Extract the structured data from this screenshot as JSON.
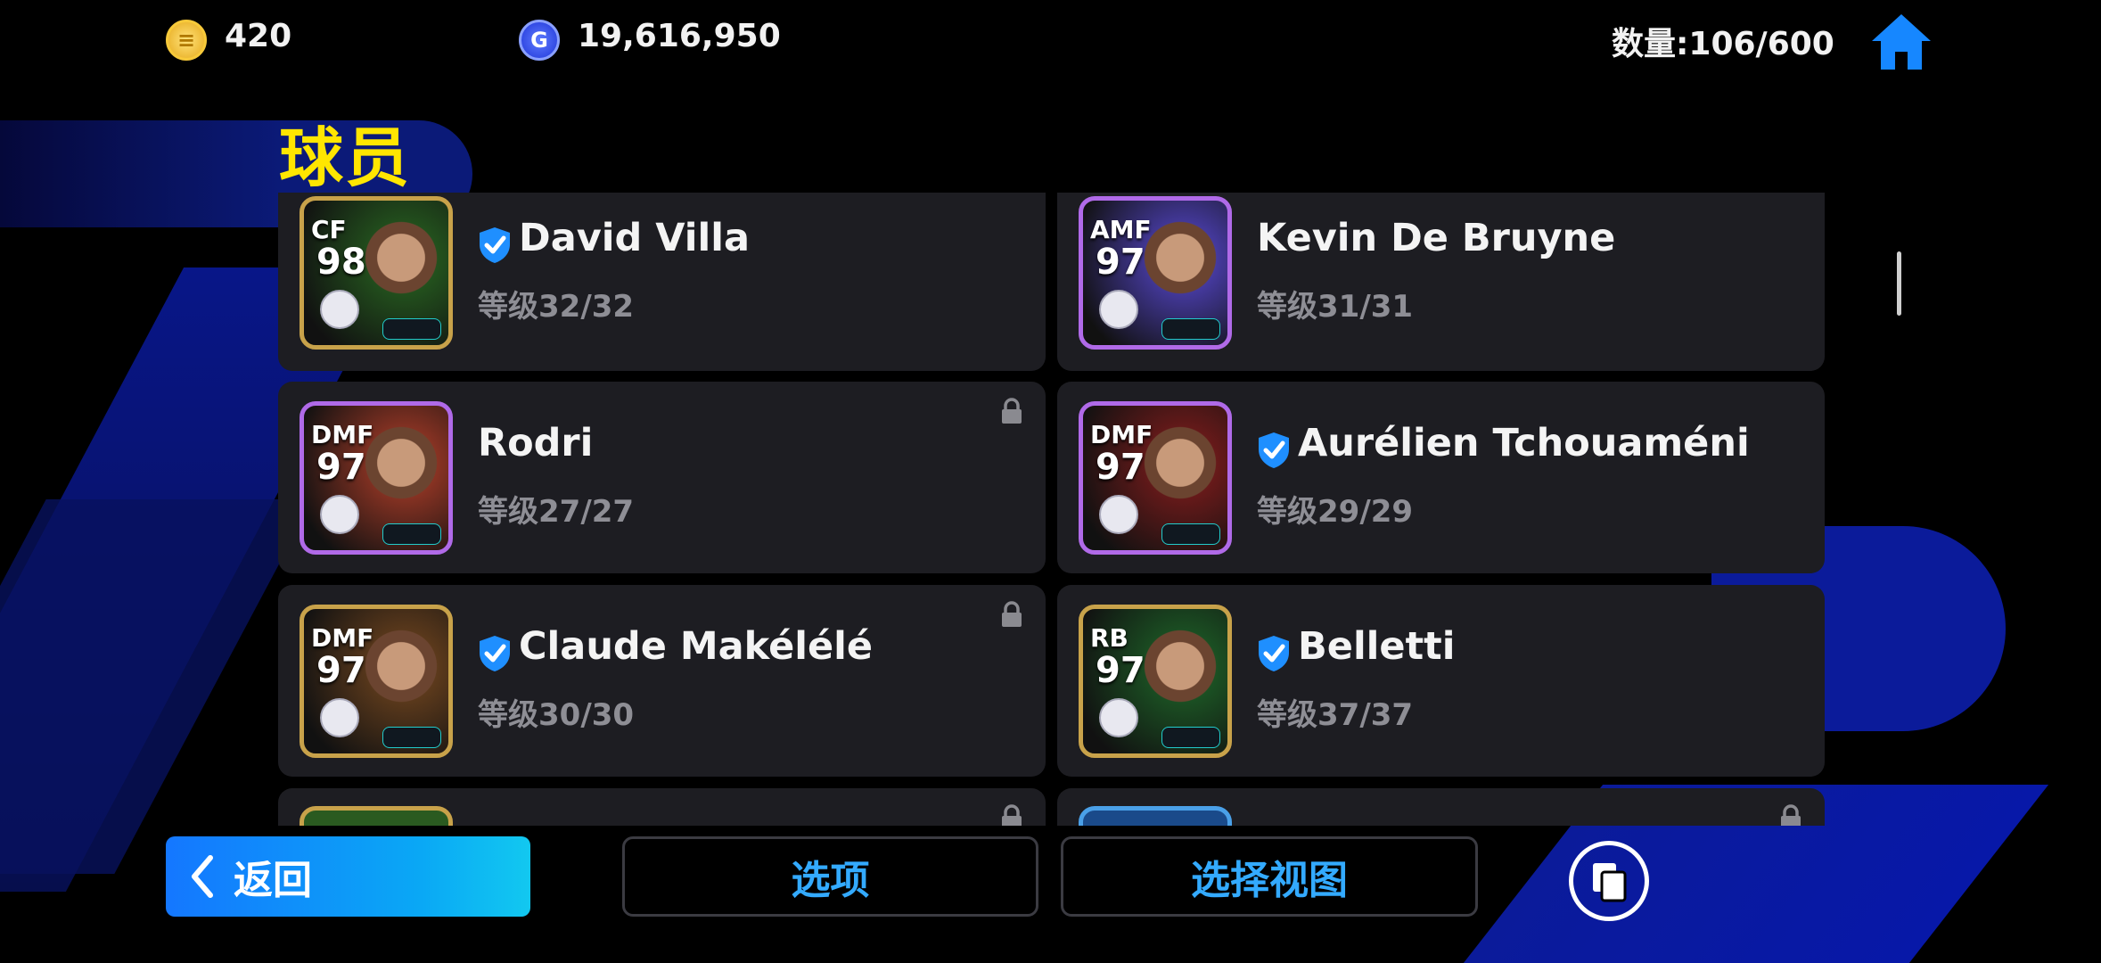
{
  "currency": {
    "coins": "420",
    "gp": "19,616,950"
  },
  "inventory_count": "数量:106/600",
  "page_title": "球员",
  "players": [
    {
      "pos": "CF",
      "rating": "98",
      "name": "David Villa",
      "level": "等级32/32",
      "verified": true,
      "locked": false,
      "frame": "gold",
      "bg": "#2a6b22"
    },
    {
      "pos": "AMF",
      "rating": "97",
      "name": "Kevin De Bruyne",
      "level": "等级31/31",
      "verified": false,
      "locked": true,
      "frame": "purple",
      "bg": "#5a4ad8"
    },
    {
      "pos": "DMF",
      "rating": "97",
      "name": "Rodri",
      "level": "等级27/27",
      "verified": false,
      "locked": true,
      "frame": "purple",
      "bg": "#b8402a"
    },
    {
      "pos": "DMF",
      "rating": "97",
      "name": "Aurélien Tchouaméni",
      "level": "等级29/29",
      "verified": true,
      "locked": false,
      "frame": "purple",
      "bg": "#8a1d1d"
    },
    {
      "pos": "DMF",
      "rating": "97",
      "name": "Claude Makélélé",
      "level": "等级30/30",
      "verified": true,
      "locked": true,
      "frame": "gold",
      "bg": "#7a4a20"
    },
    {
      "pos": "RB",
      "rating": "97",
      "name": "Belletti",
      "level": "等级37/37",
      "verified": true,
      "locked": false,
      "frame": "gold",
      "bg": "#1f6a2a"
    }
  ],
  "buttons": {
    "back": "返回",
    "options": "选项",
    "select_view": "选择视图"
  },
  "colors": {
    "title": "#ffe600",
    "accent_blue": "#33aaff",
    "verify_blue": "#1f8fff"
  }
}
